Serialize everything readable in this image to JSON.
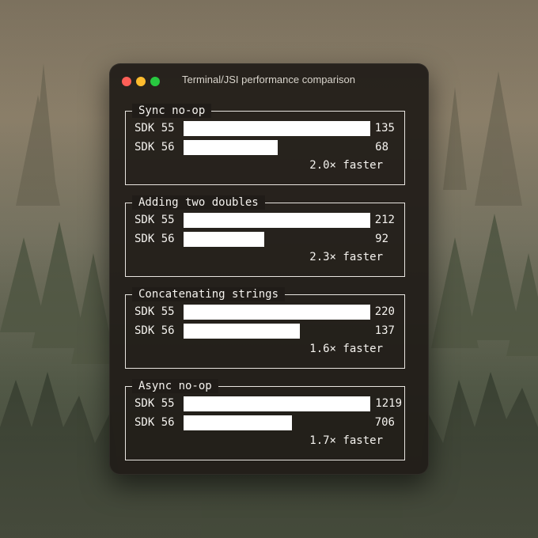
{
  "window": {
    "title": "Terminal/JSI performance comparison"
  },
  "colors": {
    "bar": "#ffffff",
    "window_bg": "#201c18",
    "close": "#ff5f57",
    "minimize": "#febc2e",
    "zoom": "#28c840"
  },
  "sections": [
    {
      "label": "Sync no-op",
      "rows": [
        {
          "sdk": "SDK 55",
          "value": "135",
          "fill": 1.0
        },
        {
          "sdk": "SDK 56",
          "value": "68",
          "fill": 0.504
        }
      ],
      "speedup": "2.0×",
      "speedup_word": "faster"
    },
    {
      "label": "Adding two doubles",
      "rows": [
        {
          "sdk": "SDK 55",
          "value": "212",
          "fill": 1.0
        },
        {
          "sdk": "SDK 56",
          "value": "92",
          "fill": 0.434
        }
      ],
      "speedup": "2.3×",
      "speedup_word": "faster"
    },
    {
      "label": "Concatenating strings",
      "rows": [
        {
          "sdk": "SDK 55",
          "value": "220",
          "fill": 1.0
        },
        {
          "sdk": "SDK 56",
          "value": "137",
          "fill": 0.623
        }
      ],
      "speedup": "1.6×",
      "speedup_word": "faster"
    },
    {
      "label": "Async no-op",
      "rows": [
        {
          "sdk": "SDK 55",
          "value": "1219",
          "fill": 1.0
        },
        {
          "sdk": "SDK 56",
          "value": "706",
          "fill": 0.579
        }
      ],
      "speedup": "1.7×",
      "speedup_word": "faster"
    }
  ]
}
